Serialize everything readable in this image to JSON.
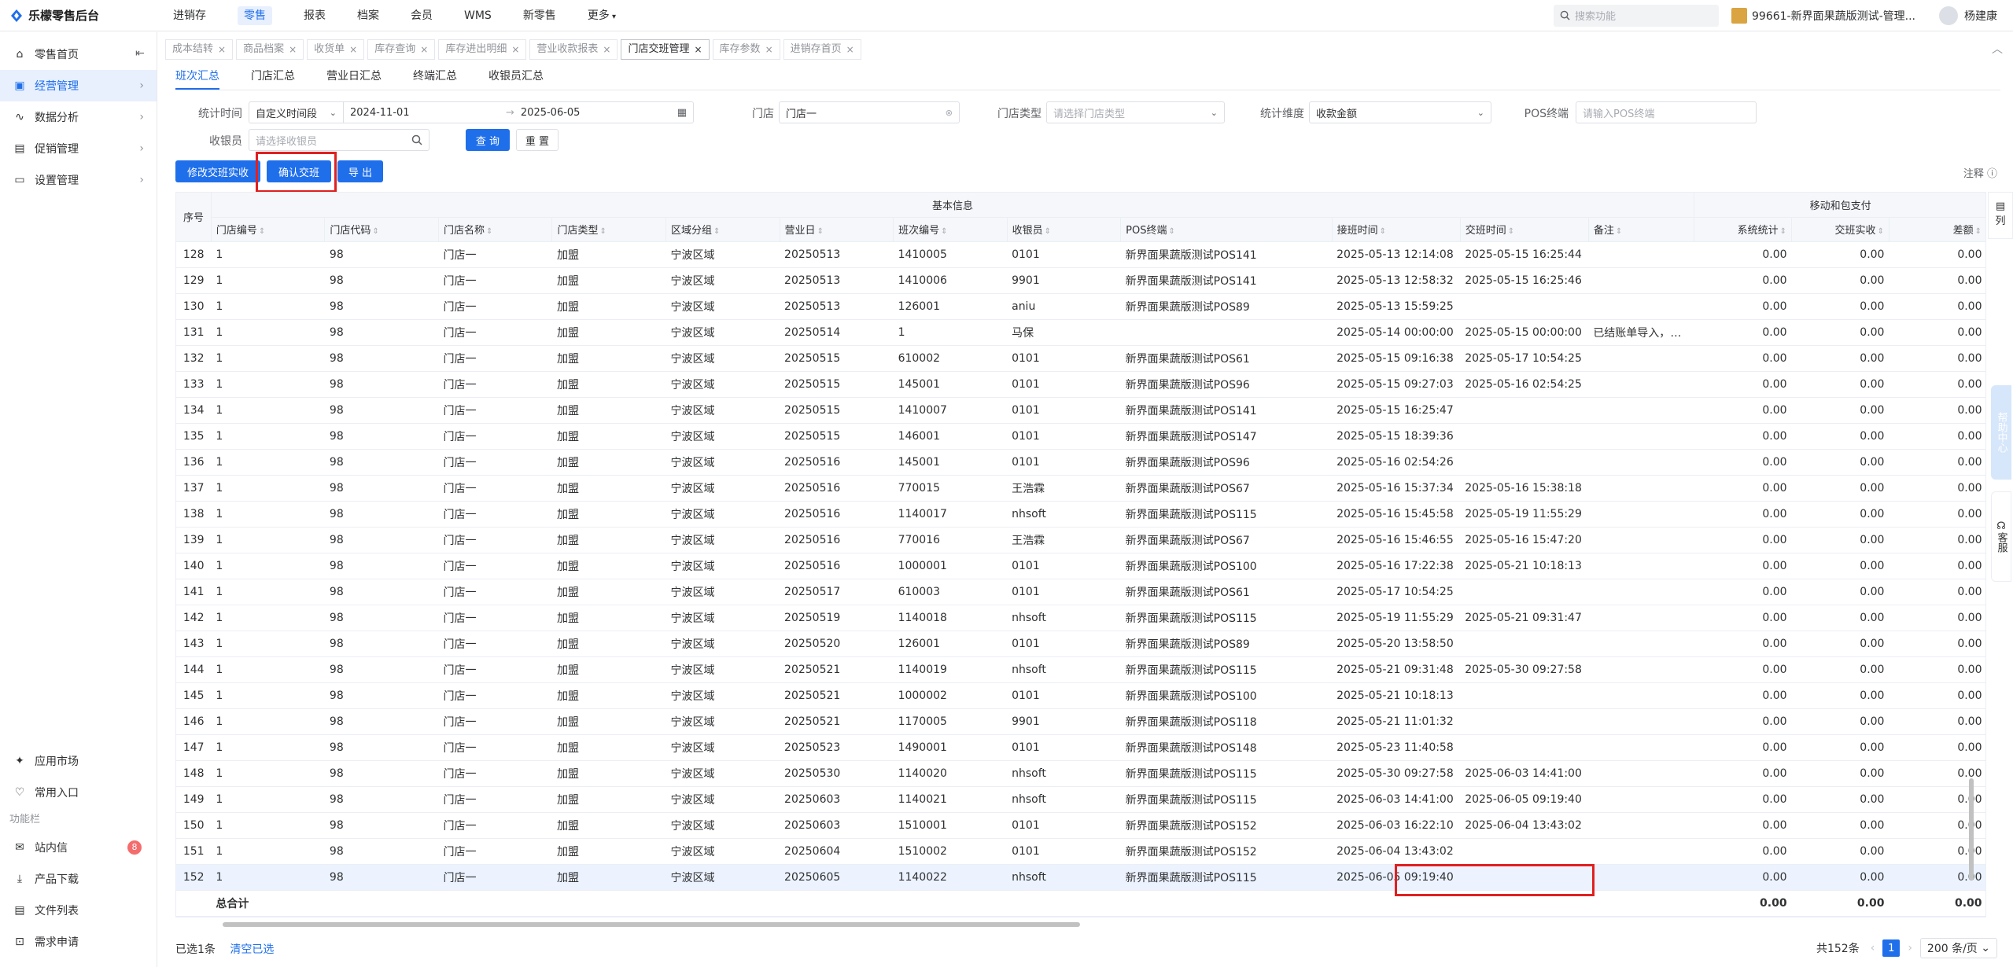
{
  "app": {
    "title": "乐檬零售后台"
  },
  "topnav": [
    "进销存",
    "零售",
    "报表",
    "档案",
    "会员",
    "WMS",
    "新零售",
    "更多"
  ],
  "top_right": {
    "search_placeholder": "搜索功能",
    "store": "99661-新界面果蔬版测试-管理...",
    "user": "杨建康"
  },
  "sidebar": {
    "items": [
      {
        "label": "零售首页",
        "icon": "home-icon"
      },
      {
        "label": "经营管理",
        "icon": "management-icon"
      },
      {
        "label": "数据分析",
        "icon": "chart-icon"
      },
      {
        "label": "促销管理",
        "icon": "promo-icon"
      },
      {
        "label": "设置管理",
        "icon": "settings-icon"
      }
    ],
    "bottom": [
      {
        "label": "应用市场",
        "icon": "app-market-icon"
      },
      {
        "label": "常用入口",
        "icon": "heart-icon"
      }
    ],
    "group_label": "功能栏",
    "tools": [
      {
        "label": "站内信",
        "badge": "8",
        "icon": "mail-icon"
      },
      {
        "label": "产品下载",
        "icon": "download-icon"
      },
      {
        "label": "文件列表",
        "icon": "file-icon"
      },
      {
        "label": "需求申请",
        "icon": "request-icon"
      }
    ]
  },
  "tabs": [
    "成本结转",
    "商品档案",
    "收货单",
    "库存查询",
    "库存进出明细",
    "营业收款报表",
    "门店交班管理",
    "库存参数",
    "进销存首页"
  ],
  "subtabs": [
    "班次汇总",
    "门店汇总",
    "营业日汇总",
    "终端汇总",
    "收银员汇总"
  ],
  "filters": {
    "stat_time_label": "统计时间",
    "stat_time_mode": "自定义时间段",
    "date_from": "2024-11-01",
    "date_to": "2025-06-05",
    "store_label": "门店",
    "store_value": "门店一",
    "store_type_label": "门店类型",
    "store_type_placeholder": "请选择门店类型",
    "dimension_label": "统计维度",
    "dimension_value": "收款金额",
    "pos_label": "POS终端",
    "pos_placeholder": "请输入POS终端",
    "cashier_label": "收银员",
    "cashier_placeholder": "请选择收银员",
    "query": "查 询",
    "reset": "重 置"
  },
  "actions": {
    "modify": "修改交班实收",
    "confirm": "确认交班",
    "export": "导 出",
    "note": "注释"
  },
  "table": {
    "group_basic": "基本信息",
    "group_pay": "移动和包支付",
    "seq_header": "序号",
    "columns": [
      "门店编号",
      "门店代码",
      "门店名称",
      "门店类型",
      "区域分组",
      "营业日",
      "班次编号",
      "收银员",
      "POS终端",
      "接班时间",
      "交班时间",
      "备注",
      "系统统计",
      "交班实收",
      "差额"
    ],
    "rows": [
      [
        "128",
        "1",
        "98",
        "门店一",
        "加盟",
        "宁波区域",
        "20250513",
        "1410005",
        "0101",
        "新界面果蔬版测试POS141",
        "2025-05-13 12:14:08",
        "2025-05-15 16:25:44",
        "",
        "0.00",
        "0.00",
        "0.00"
      ],
      [
        "129",
        "1",
        "98",
        "门店一",
        "加盟",
        "宁波区域",
        "20250513",
        "1410006",
        "9901",
        "新界面果蔬版测试POS141",
        "2025-05-13 12:58:32",
        "2025-05-15 16:25:46",
        "",
        "0.00",
        "0.00",
        "0.00"
      ],
      [
        "130",
        "1",
        "98",
        "门店一",
        "加盟",
        "宁波区域",
        "20250513",
        "126001",
        "aniu",
        "新界面果蔬版测试POS89",
        "2025-05-13 15:59:25",
        "",
        "",
        "0.00",
        "0.00",
        "0.00"
      ],
      [
        "131",
        "1",
        "98",
        "门店一",
        "加盟",
        "宁波区域",
        "20250514",
        "1",
        "马保",
        "",
        "2025-05-14 00:00:00",
        "2025-05-15 00:00:00",
        "已结账单导入，自...",
        "0.00",
        "0.00",
        "0.00"
      ],
      [
        "132",
        "1",
        "98",
        "门店一",
        "加盟",
        "宁波区域",
        "20250515",
        "610002",
        "0101",
        "新界面果蔬版测试POS61",
        "2025-05-15 09:16:38",
        "2025-05-17 10:54:25",
        "",
        "0.00",
        "0.00",
        "0.00"
      ],
      [
        "133",
        "1",
        "98",
        "门店一",
        "加盟",
        "宁波区域",
        "20250515",
        "145001",
        "0101",
        "新界面果蔬版测试POS96",
        "2025-05-15 09:27:03",
        "2025-05-16 02:54:25",
        "",
        "0.00",
        "0.00",
        "0.00"
      ],
      [
        "134",
        "1",
        "98",
        "门店一",
        "加盟",
        "宁波区域",
        "20250515",
        "1410007",
        "0101",
        "新界面果蔬版测试POS141",
        "2025-05-15 16:25:47",
        "",
        "",
        "0.00",
        "0.00",
        "0.00"
      ],
      [
        "135",
        "1",
        "98",
        "门店一",
        "加盟",
        "宁波区域",
        "20250515",
        "146001",
        "0101",
        "新界面果蔬版测试POS147",
        "2025-05-15 18:39:36",
        "",
        "",
        "0.00",
        "0.00",
        "0.00"
      ],
      [
        "136",
        "1",
        "98",
        "门店一",
        "加盟",
        "宁波区域",
        "20250516",
        "145001",
        "0101",
        "新界面果蔬版测试POS96",
        "2025-05-16 02:54:26",
        "",
        "",
        "0.00",
        "0.00",
        "0.00"
      ],
      [
        "137",
        "1",
        "98",
        "门店一",
        "加盟",
        "宁波区域",
        "20250516",
        "770015",
        "王浩霖",
        "新界面果蔬版测试POS67",
        "2025-05-16 15:37:34",
        "2025-05-16 15:38:18",
        "",
        "0.00",
        "0.00",
        "0.00"
      ],
      [
        "138",
        "1",
        "98",
        "门店一",
        "加盟",
        "宁波区域",
        "20250516",
        "1140017",
        "nhsoft",
        "新界面果蔬版测试POS115",
        "2025-05-16 15:45:58",
        "2025-05-19 11:55:29",
        "",
        "0.00",
        "0.00",
        "0.00"
      ],
      [
        "139",
        "1",
        "98",
        "门店一",
        "加盟",
        "宁波区域",
        "20250516",
        "770016",
        "王浩霖",
        "新界面果蔬版测试POS67",
        "2025-05-16 15:46:55",
        "2025-05-16 15:47:20",
        "",
        "0.00",
        "0.00",
        "0.00"
      ],
      [
        "140",
        "1",
        "98",
        "门店一",
        "加盟",
        "宁波区域",
        "20250516",
        "1000001",
        "0101",
        "新界面果蔬版测试POS100",
        "2025-05-16 17:22:38",
        "2025-05-21 10:18:13",
        "",
        "0.00",
        "0.00",
        "0.00"
      ],
      [
        "141",
        "1",
        "98",
        "门店一",
        "加盟",
        "宁波区域",
        "20250517",
        "610003",
        "0101",
        "新界面果蔬版测试POS61",
        "2025-05-17 10:54:25",
        "",
        "",
        "0.00",
        "0.00",
        "0.00"
      ],
      [
        "142",
        "1",
        "98",
        "门店一",
        "加盟",
        "宁波区域",
        "20250519",
        "1140018",
        "nhsoft",
        "新界面果蔬版测试POS115",
        "2025-05-19 11:55:29",
        "2025-05-21 09:31:47",
        "",
        "0.00",
        "0.00",
        "0.00"
      ],
      [
        "143",
        "1",
        "98",
        "门店一",
        "加盟",
        "宁波区域",
        "20250520",
        "126001",
        "0101",
        "新界面果蔬版测试POS89",
        "2025-05-20 13:58:50",
        "",
        "",
        "0.00",
        "0.00",
        "0.00"
      ],
      [
        "144",
        "1",
        "98",
        "门店一",
        "加盟",
        "宁波区域",
        "20250521",
        "1140019",
        "nhsoft",
        "新界面果蔬版测试POS115",
        "2025-05-21 09:31:48",
        "2025-05-30 09:27:58",
        "",
        "0.00",
        "0.00",
        "0.00"
      ],
      [
        "145",
        "1",
        "98",
        "门店一",
        "加盟",
        "宁波区域",
        "20250521",
        "1000002",
        "0101",
        "新界面果蔬版测试POS100",
        "2025-05-21 10:18:13",
        "",
        "",
        "0.00",
        "0.00",
        "0.00"
      ],
      [
        "146",
        "1",
        "98",
        "门店一",
        "加盟",
        "宁波区域",
        "20250521",
        "1170005",
        "9901",
        "新界面果蔬版测试POS118",
        "2025-05-21 11:01:32",
        "",
        "",
        "0.00",
        "0.00",
        "0.00"
      ],
      [
        "147",
        "1",
        "98",
        "门店一",
        "加盟",
        "宁波区域",
        "20250523",
        "1490001",
        "0101",
        "新界面果蔬版测试POS148",
        "2025-05-23 11:40:58",
        "",
        "",
        "0.00",
        "0.00",
        "0.00"
      ],
      [
        "148",
        "1",
        "98",
        "门店一",
        "加盟",
        "宁波区域",
        "20250530",
        "1140020",
        "nhsoft",
        "新界面果蔬版测试POS115",
        "2025-05-30 09:27:58",
        "2025-06-03 14:41:00",
        "",
        "0.00",
        "0.00",
        "0.00"
      ],
      [
        "149",
        "1",
        "98",
        "门店一",
        "加盟",
        "宁波区域",
        "20250603",
        "1140021",
        "nhsoft",
        "新界面果蔬版测试POS115",
        "2025-06-03 14:41:00",
        "2025-06-05 09:19:40",
        "",
        "0.00",
        "0.00",
        "0.00"
      ],
      [
        "150",
        "1",
        "98",
        "门店一",
        "加盟",
        "宁波区域",
        "20250603",
        "1510001",
        "0101",
        "新界面果蔬版测试POS152",
        "2025-06-03 16:22:10",
        "2025-06-04 13:43:02",
        "",
        "0.00",
        "0.00",
        "0.00"
      ],
      [
        "151",
        "1",
        "98",
        "门店一",
        "加盟",
        "宁波区域",
        "20250604",
        "1510002",
        "0101",
        "新界面果蔬版测试POS152",
        "2025-06-04 13:43:02",
        "",
        "",
        "0.00",
        "0.00",
        "0.00"
      ],
      [
        "152",
        "1",
        "98",
        "门店一",
        "加盟",
        "宁波区域",
        "20250605",
        "1140022",
        "nhsoft",
        "新界面果蔬版测试POS115",
        "2025-06-05 09:19:40",
        "",
        "",
        "0.00",
        "0.00",
        "0.00"
      ]
    ],
    "total_label": "总合计",
    "totals": [
      "0.00",
      "0.00",
      "0.00"
    ]
  },
  "footer": {
    "selected": "已选1条",
    "clear": "清空已选",
    "total": "共152条",
    "page": "1",
    "page_size": "200 条/页"
  },
  "floating": {
    "help": "帮助中心",
    "service": "客服",
    "side_tools": "列"
  },
  "colors": {
    "primary": "#1f6feb",
    "highlight": "#e02020",
    "selected_row": "#ecf3ff"
  }
}
